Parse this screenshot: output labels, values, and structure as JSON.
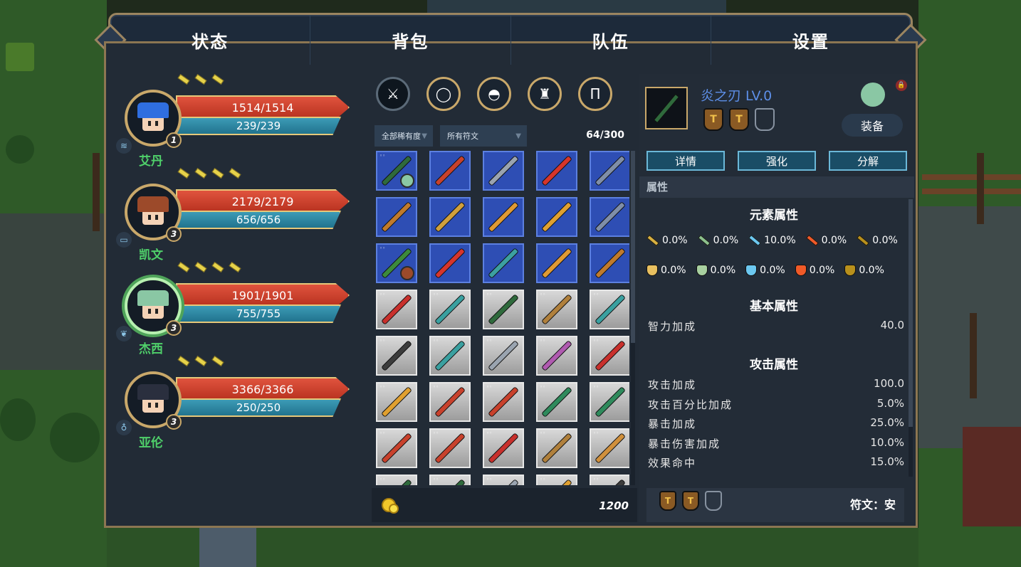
{
  "tabs": [
    "状态",
    "背包",
    "队伍",
    "设置"
  ],
  "party": [
    {
      "name": "艾丹",
      "hp": "1514/1514",
      "mp": "239/239",
      "level": "1",
      "pips": 3,
      "hair": "#2f6ee0",
      "element_icon": "wave-icon"
    },
    {
      "name": "凯文",
      "hp": "2179/2179",
      "mp": "656/656",
      "level": "3",
      "pips": 4,
      "hair": "#9c4a2a",
      "element_icon": "terrain-icon"
    },
    {
      "name": "杰西",
      "hp": "1901/1901",
      "mp": "755/755",
      "level": "3",
      "pips": 4,
      "hair": "#8ac7a4",
      "element_icon": "leaf-icon",
      "selected": true
    },
    {
      "name": "亚伦",
      "hp": "3366/3366",
      "mp": "250/250",
      "level": "3",
      "pips": 3,
      "hair": "#2a2f3e",
      "element_icon": "drop-icon"
    }
  ],
  "inventory": {
    "categories": [
      "sword-icon",
      "ring-icon",
      "helmet-icon",
      "armor-icon",
      "pants-icon"
    ],
    "filter_rarity": "全部稀有度",
    "filter_rune": "所有符文",
    "count": "64/300",
    "gold": "1200",
    "items": [
      {
        "bg": "blue",
        "color": "#2f6a3c",
        "dots": true,
        "owner": "#8ac7a4"
      },
      {
        "bg": "blue",
        "color": "#c8412c"
      },
      {
        "bg": "blue",
        "color": "#9aa4b0"
      },
      {
        "bg": "blue",
        "color": "#d6352c"
      },
      {
        "bg": "blue",
        "color": "#7f8ea8"
      },
      {
        "bg": "blue",
        "color": "#c07a2c"
      },
      {
        "bg": "blue",
        "color": "#d0a03c"
      },
      {
        "bg": "blue",
        "color": "#e09a34"
      },
      {
        "bg": "blue",
        "color": "#e0a030"
      },
      {
        "bg": "blue",
        "color": "#7f8ea8"
      },
      {
        "bg": "blue",
        "color": "#3c8a3c",
        "dots": true,
        "owner": "#9c4a2a"
      },
      {
        "bg": "blue",
        "color": "#d6352c"
      },
      {
        "bg": "blue",
        "color": "#3ca0a0"
      },
      {
        "bg": "blue",
        "color": "#e09a34"
      },
      {
        "bg": "blue",
        "color": "#c07a2c"
      },
      {
        "bg": "grey",
        "color": "#c8302c",
        "dots": true
      },
      {
        "bg": "grey",
        "color": "#3aa0a0",
        "dots": true
      },
      {
        "bg": "grey",
        "color": "#2f6a3c",
        "dots": true
      },
      {
        "bg": "grey",
        "color": "#b0803c",
        "dots": true
      },
      {
        "bg": "grey",
        "color": "#3aa0a0",
        "dots": true
      },
      {
        "bg": "grey",
        "color": "#3c3c3c",
        "dots": true
      },
      {
        "bg": "grey",
        "color": "#3aa0a0",
        "dots": true
      },
      {
        "bg": "grey",
        "color": "#9aa4b0",
        "dots": true
      },
      {
        "bg": "grey",
        "color": "#b05ab0",
        "dots": true
      },
      {
        "bg": "grey",
        "color": "#c8302c",
        "dots": true
      },
      {
        "bg": "grey",
        "color": "#e0a030",
        "dots": true
      },
      {
        "bg": "grey",
        "color": "#c8412c",
        "dots": true
      },
      {
        "bg": "grey",
        "color": "#c8412c",
        "dots": true
      },
      {
        "bg": "grey",
        "color": "#2f8a5c",
        "dots": true
      },
      {
        "bg": "grey",
        "color": "#2f8a5c",
        "dots": true
      },
      {
        "bg": "grey",
        "color": "#c8412c",
        "dots": true
      },
      {
        "bg": "grey",
        "color": "#c8412c",
        "dots": true
      },
      {
        "bg": "grey",
        "color": "#c8302c",
        "dots": true
      },
      {
        "bg": "grey",
        "color": "#b0803c",
        "dots": true
      },
      {
        "bg": "grey",
        "color": "#d0903c",
        "dots": true
      },
      {
        "bg": "grey",
        "color": "#2f6a3c",
        "dots": true
      },
      {
        "bg": "grey",
        "color": "#2f6a3c",
        "dots": true
      },
      {
        "bg": "grey",
        "color": "#9aa4b0",
        "dots": true
      },
      {
        "bg": "grey",
        "color": "#e0a030",
        "dots": true
      },
      {
        "bg": "grey",
        "color": "#3c3c3c",
        "dots": true
      }
    ]
  },
  "detail": {
    "title": "炎之刃 LV.0",
    "equip_label": "装备",
    "lock_icon": "lock-icon",
    "runes": [
      "T",
      "T",
      ""
    ],
    "actions": [
      "详情",
      "强化",
      "分解"
    ],
    "attr_header": "属性",
    "element_title": "元素属性",
    "element_attack": [
      {
        "value": "0.0%",
        "color": "#d8b040"
      },
      {
        "value": "0.0%",
        "color": "#8cc08c"
      },
      {
        "value": "10.0%",
        "color": "#6cc8f0"
      },
      {
        "value": "0.0%",
        "color": "#f05a28"
      },
      {
        "value": "0.0%",
        "color": "#b8901c"
      }
    ],
    "element_defense": [
      {
        "value": "0.0%",
        "color": "#e8c060"
      },
      {
        "value": "0.0%",
        "color": "#a8d0a0"
      },
      {
        "value": "0.0%",
        "color": "#6cc8f0"
      },
      {
        "value": "0.0%",
        "color": "#f05a28"
      },
      {
        "value": "0.0%",
        "color": "#b8901c"
      }
    ],
    "basic_title": "基本属性",
    "basic": [
      {
        "label": "智力加成",
        "value": "40.0"
      }
    ],
    "attack_title": "攻击属性",
    "attack": [
      {
        "label": "攻击加成",
        "value": "100.0"
      },
      {
        "label": "攻击百分比加成",
        "value": "5.0%"
      },
      {
        "label": "暴击加成",
        "value": "25.0%"
      },
      {
        "label": "暴击伤害加成",
        "value": "10.0%"
      },
      {
        "label": "效果命中",
        "value": "15.0%"
      }
    ],
    "rune_footer_label": "符文：安"
  }
}
